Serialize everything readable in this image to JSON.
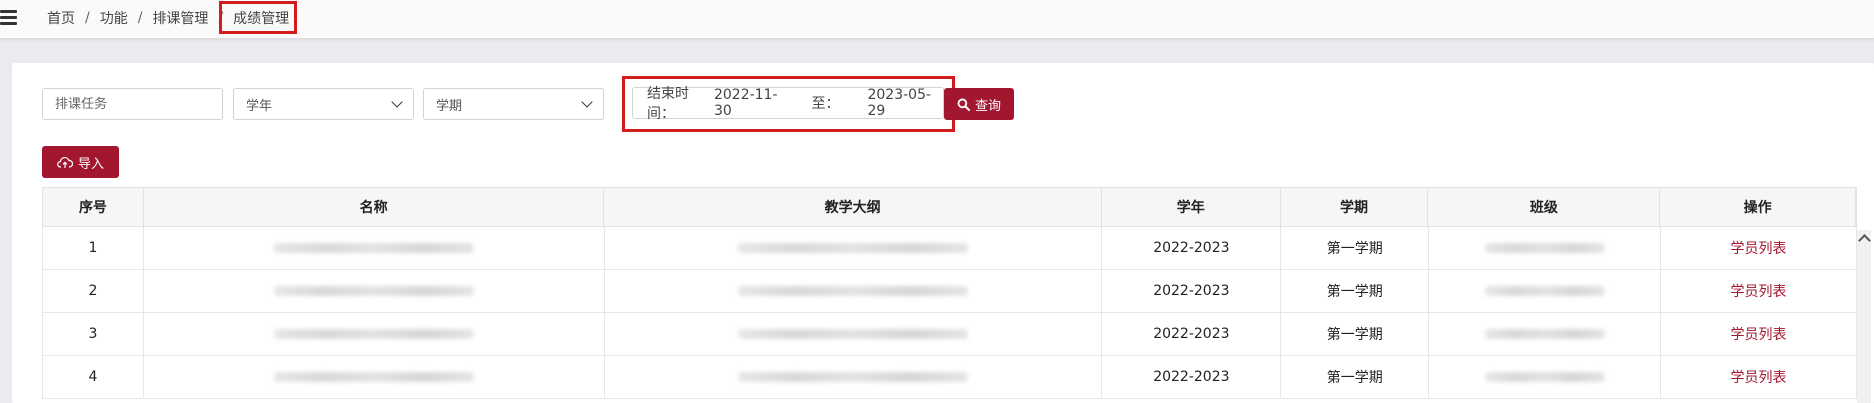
{
  "breadcrumb": {
    "items": [
      "首页",
      "功能",
      "排课管理"
    ],
    "current": "成绩管理",
    "separator": "/"
  },
  "filters": {
    "task_placeholder": "排课任务",
    "year_select": "学年",
    "term_select": "学期",
    "end_time_label": "结束时间：",
    "start_date": "2022-11-30",
    "to_label": "至：",
    "end_date": "2023-05-29",
    "search_label": "查询"
  },
  "actions": {
    "import_label": "导入"
  },
  "table": {
    "headers": [
      "序号",
      "名称",
      "教学大纲",
      "学年",
      "学期",
      "班级",
      "操作"
    ],
    "rows": [
      {
        "index": "1",
        "year": "2022-2023",
        "term": "第一学期",
        "action": "学员列表"
      },
      {
        "index": "2",
        "year": "2022-2023",
        "term": "第一学期",
        "action": "学员列表"
      },
      {
        "index": "3",
        "year": "2022-2023",
        "term": "第一学期",
        "action": "学员列表"
      },
      {
        "index": "4",
        "year": "2022-2023",
        "term": "第一学期",
        "action": "学员列表"
      }
    ]
  },
  "colors": {
    "accent": "#a2162f",
    "highlight_border": "#d31b1b"
  }
}
